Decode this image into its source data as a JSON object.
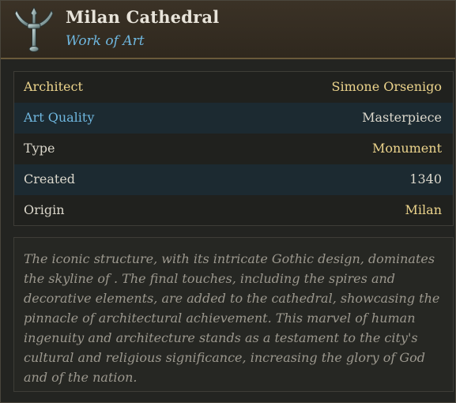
{
  "header": {
    "icon": "trident-standard-icon",
    "title": "Milan Cathedral",
    "subtitle": "Work of Art"
  },
  "stats": [
    {
      "label": "Architect",
      "value": "Simone Orsenigo",
      "label_color": "#ecd48c",
      "value_color": "#ecd48c"
    },
    {
      "label": "Art Quality",
      "value": "Masterpiece",
      "label_color": "#6fb7df",
      "value_color": "#dcd8cc"
    },
    {
      "label": "Type",
      "value": "Monument",
      "label_color": "#dcd8cc",
      "value_color": "#ecd48c"
    },
    {
      "label": "Created",
      "value": "1340",
      "label_color": "#dcd8cc",
      "value_color": "#dcd8cc"
    },
    {
      "label": "Origin",
      "value": "Milan",
      "label_color": "#dcd8cc",
      "value_color": "#ecd48c"
    }
  ],
  "description": "The iconic structure, with its intricate Gothic design, dominates the skyline of . The final touches, including the spires and decorative elements, are added to the cathedral, showcasing the pinnacle of architectural achievement. This marvel of human ingenuity and architecture stands as a testament to the city's cultural and religious significance, increasing the glory of God and of the nation."
}
